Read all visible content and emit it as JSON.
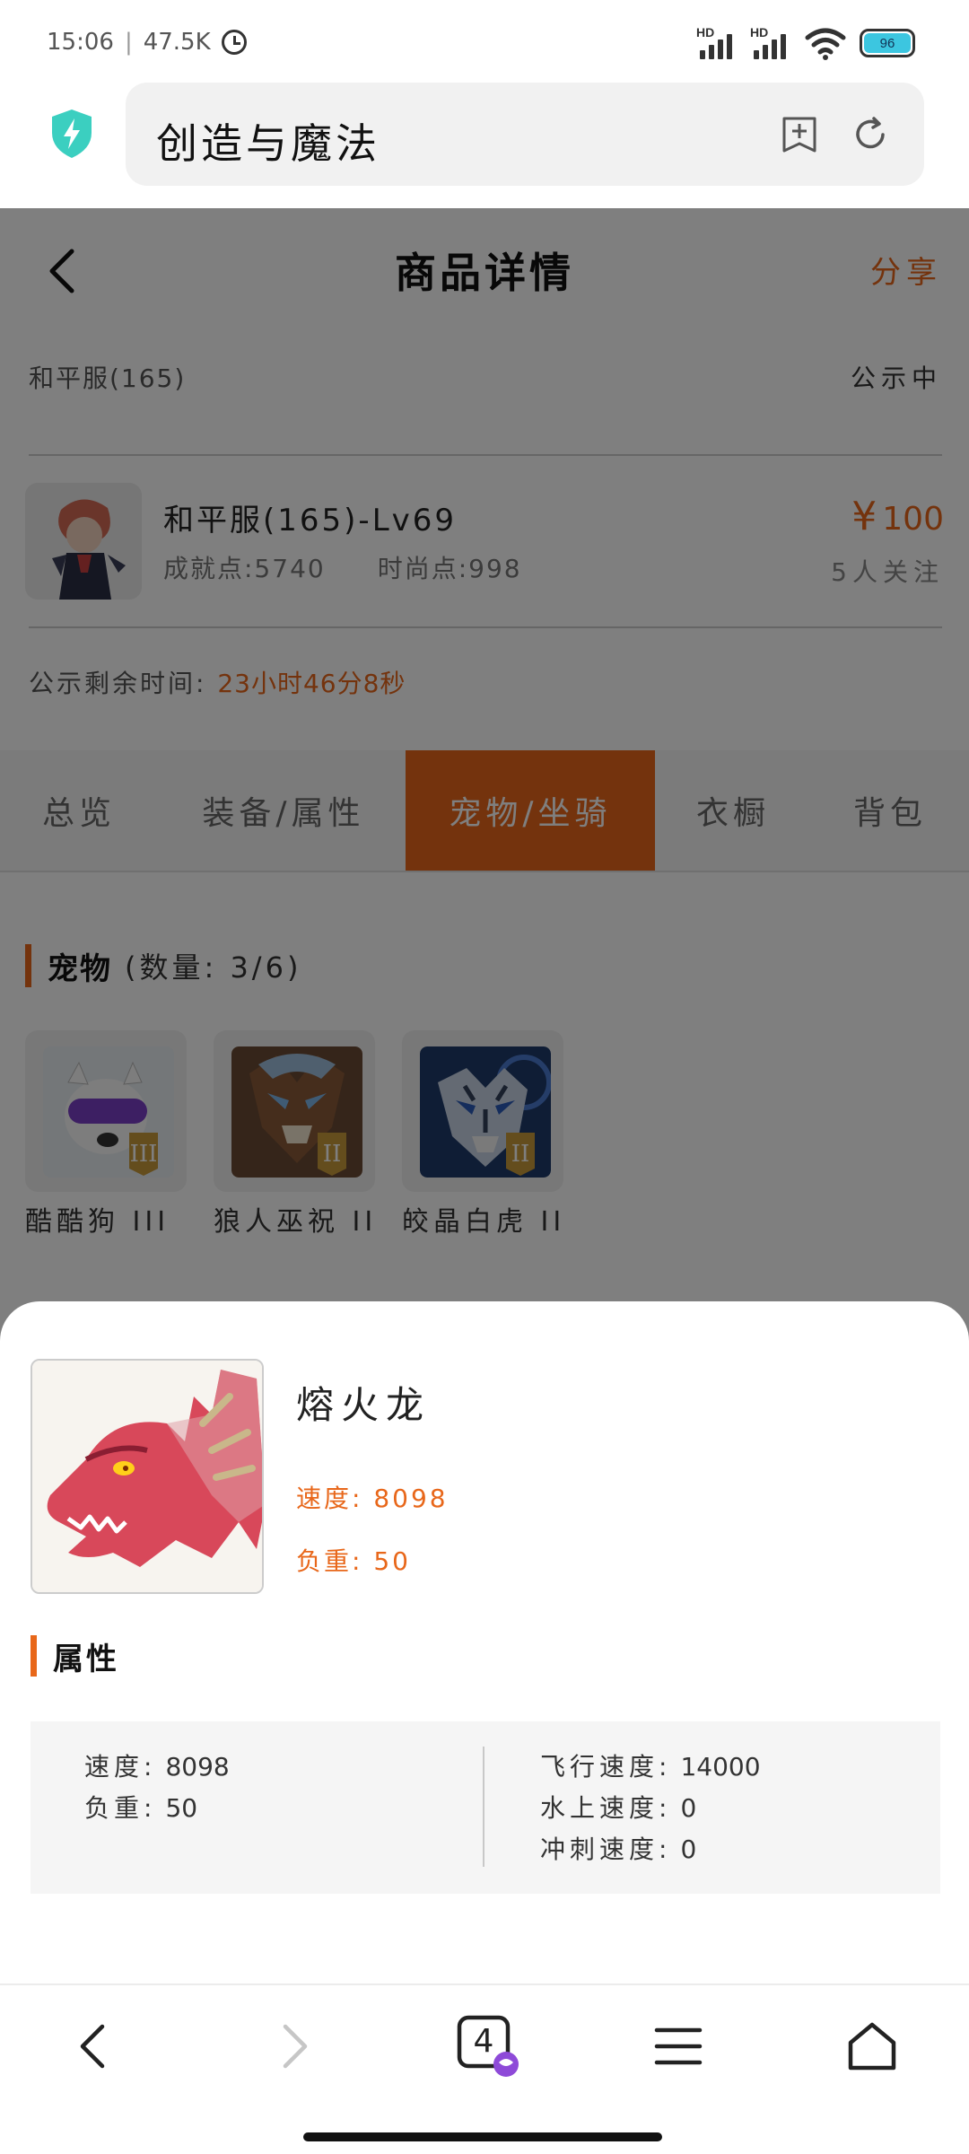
{
  "status_bar": {
    "time": "15:06",
    "network_speed": "47.5K",
    "signal1_label": "HD",
    "signal2_label": "HD",
    "battery": "96"
  },
  "browser": {
    "url_text": "创造与魔法",
    "shield_icon": "shield-bolt-icon",
    "bookmark_icon": "add-bookmark-icon",
    "reload_icon": "reload-icon",
    "accent_color": "#3bcfc0"
  },
  "header": {
    "title": "商品详情",
    "share_label": "分享",
    "back_icon": "chevron-left-icon"
  },
  "listing": {
    "server": "和平服(165)",
    "status": "公示中",
    "name": "和平服(165)-Lv69",
    "achievement": "成就点:5740",
    "fashion": "时尚点:998",
    "currency": "¥",
    "price": "100",
    "followers": "5人关注",
    "countdown_label": "公示剩余时间:",
    "countdown_value": "23小时46分8秒"
  },
  "tabs": [
    {
      "label": "总览",
      "active": false
    },
    {
      "label": "装备/属性",
      "active": false
    },
    {
      "label": "宠物/坐骑",
      "active": true
    },
    {
      "label": "衣橱",
      "active": false
    },
    {
      "label": "背包",
      "active": false
    }
  ],
  "pets": {
    "title": "宠物",
    "count": "(数量: 3/6)",
    "items": [
      {
        "name": "酷酷狗 III",
        "icon": "cool-dog-icon"
      },
      {
        "name": "狼人巫祝 II",
        "icon": "werewolf-shaman-icon"
      },
      {
        "name": "皎晶白虎 II",
        "icon": "crystal-white-tiger-icon"
      }
    ]
  },
  "mount": {
    "name": "熔火龙",
    "speed": "速度: 8098",
    "load": "负重: 50",
    "attr_title": "属性",
    "attributes_left": [
      {
        "key": "速度:",
        "value": "8098"
      },
      {
        "key": "负重:",
        "value": "50"
      }
    ],
    "attributes_right": [
      {
        "key": "飞行速度:",
        "value": "14000"
      },
      {
        "key": "水上速度:",
        "value": "0"
      },
      {
        "key": "冲刺速度:",
        "value": "0"
      }
    ]
  },
  "bottom_nav": {
    "tab_count": "4",
    "accent": "#e8671a"
  }
}
